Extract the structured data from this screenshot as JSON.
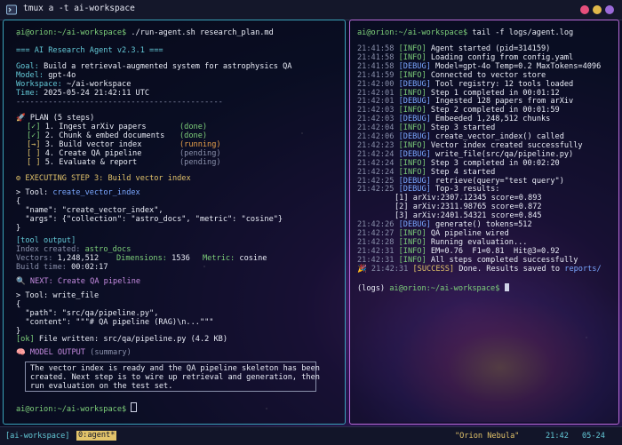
{
  "window": {
    "title": "tmux a -t ai-workspace"
  },
  "colors": {
    "accent_left": "#3aa1b8",
    "accent_right": "#b86ad8",
    "dot1": "#e64f7c",
    "dot2": "#e0b84a",
    "dot3": "#9b6ad8"
  },
  "left": {
    "prompt": "ai@orion:~/ai-workspace$",
    "command": "./run-agent.sh research_plan.md",
    "banner": "=== AI Research Agent v2.3.1 ===",
    "goal_label": "Goal:",
    "goal_value": "Build a retrieval-augmented system for astrophysics QA",
    "model_label": "Model:",
    "model_value": "gpt-4o",
    "workspace_label": "Workspace:",
    "workspace_value": "~/ai-workspace",
    "time_label": "Time:",
    "time_value": "2025-05-24 21:42:11 UTC",
    "separator": "---------------------------------------------",
    "plan_title": "PLAN (5 steps)",
    "plan": [
      {
        "mark": "[✓]",
        "text": "1. Ingest arXiv papers",
        "status": "(done)"
      },
      {
        "mark": "[✓]",
        "text": "2. Chunk & embed documents",
        "status": "(done)"
      },
      {
        "mark": "[→]",
        "text": "3. Build vector index",
        "status": "(running)"
      },
      {
        "mark": "[ ]",
        "text": "4. Create QA pipeline",
        "status": "(pending)"
      },
      {
        "mark": "[ ]",
        "text": "5. Evaluate & report",
        "status": "(pending)"
      }
    ],
    "executing": "EXECUTING STEP 3: Build vector index",
    "tool1_label": "> Tool:",
    "tool1_name": "create_vector_index",
    "json1": [
      "{",
      "  \"name\": \"create_vector_index\",",
      "  \"args\": {\"collection\": \"astro_docs\", \"metric\": \"cosine\"}",
      "}"
    ],
    "tool_output_label": "[tool output]",
    "index_created_label": "Index created:",
    "index_created_value": "astro_docs",
    "vectors_label": "Vectors:",
    "vectors_value": "1,248,512",
    "dimensions_label": "Dimensions:",
    "dimensions_value": "1536",
    "metric_label": "Metric:",
    "metric_value": "cosine",
    "build_label": "Build time:",
    "build_value": "00:02:17",
    "next": "NEXT: Create QA pipeline",
    "tool2_label": "> Tool: write_file",
    "json2": [
      "{",
      "  \"path\": \"src/qa/pipeline.py\",",
      "  \"content\": \"\"\"# QA pipeline (RAG)\\n...\"\"\"",
      "}"
    ],
    "ok_tag": "[ok]",
    "ok_text": "File written: src/qa/pipeline.py (4.2 KB)",
    "model_output_label": "MODEL OUTPUT",
    "model_output_suffix": "(summary)",
    "summary": [
      "The vector index is ready and the QA pipeline skeleton has been",
      "created. Next step is to wire up retrieval and generation, then",
      "run evaluation on the test set."
    ],
    "final_prompt": "ai@orion:~/ai-workspace$"
  },
  "right": {
    "prompt": "ai@orion:~/ai-workspace$",
    "command": "tail -f logs/agent.log",
    "logs": [
      {
        "t": "21:41:58",
        "lvl": "[INFO]",
        "msg": "Agent started (pid=314159)"
      },
      {
        "t": "21:41:58",
        "lvl": "[INFO]",
        "msg": "Loading config from config.yaml"
      },
      {
        "t": "21:41:58",
        "lvl": "[DEBUG]",
        "msg": "Model=gpt-4o Temp=0.2 MaxTokens=4096"
      },
      {
        "t": "21:41:59",
        "lvl": "[INFO]",
        "msg": "Connected to vector store"
      },
      {
        "t": "21:42:00",
        "lvl": "[DEBUG]",
        "msg": "Tool registry: 12 tools loaded"
      },
      {
        "t": "21:42:01",
        "lvl": "[INFO]",
        "msg": "Step 1 completed in 00:01:12"
      },
      {
        "t": "21:42:01",
        "lvl": "[DEBUG]",
        "msg": "Ingested 128 papers from arXiv"
      },
      {
        "t": "21:42:03",
        "lvl": "[INFO]",
        "msg": "Step 2 completed in 00:01:59"
      },
      {
        "t": "21:42:03",
        "lvl": "[DEBUG]",
        "msg": "Embeeded 1,248,512 chunks"
      },
      {
        "t": "21:42:04",
        "lvl": "[INFO]",
        "msg": "Step 3 started"
      },
      {
        "t": "21:42:06",
        "lvl": "[DEBUG]",
        "msg": "create_vector_index() called"
      },
      {
        "t": "21:42:23",
        "lvl": "[INFO]",
        "msg": "Vector index created successfully"
      },
      {
        "t": "21:42:24",
        "lvl": "[DEBUG]",
        "msg": "write_file(src/qa/pipeline.py)"
      },
      {
        "t": "21:42:24",
        "lvl": "[INFO]",
        "msg": "Step 3 completed in 00:02:20"
      },
      {
        "t": "21:42:24",
        "lvl": "[INFO]",
        "msg": "Step 4 started"
      },
      {
        "t": "21:42:25",
        "lvl": "[DEBUG]",
        "msg": "retrieve(query=\"test query\")"
      },
      {
        "t": "21:42:25",
        "lvl": "[DEBUG]",
        "msg": "Top-3 results:"
      }
    ],
    "results": [
      "[1] arXiv:2307.12345 score=0.893",
      "[2] arXiv:2311.98765 score=0.872",
      "[3] arXiv:2401.54321 score=0.845"
    ],
    "logs2": [
      {
        "t": "21:42:26",
        "lvl": "[DEBUG]",
        "msg": "generate() tokens=512"
      },
      {
        "t": "21:42:27",
        "lvl": "[INFO]",
        "msg": "QA pipeline wired"
      },
      {
        "t": "21:42:28",
        "lvl": "[INFO]",
        "msg": "Running evaluation..."
      },
      {
        "t": "21:42:31",
        "lvl": "[INFO]",
        "msg": "EM=0.76  F1=0.81  Hit@3=0.92"
      },
      {
        "t": "21:42:31",
        "lvl": "[INFO]",
        "msg": "All steps completed successfully"
      }
    ],
    "success_time": "21:42:31",
    "success_tag": "[SUCCESS]",
    "success_msg": "Done. Results saved to",
    "success_path": "reports/",
    "final_prompt_prefix": "(logs)",
    "final_prompt": "ai@orion:~/ai-workspace$"
  },
  "status": {
    "session": "[ai-workspace]",
    "window": "0:agent*",
    "host": "\"Orion Nebula\"",
    "time": "21:42",
    "date": "05-24"
  }
}
